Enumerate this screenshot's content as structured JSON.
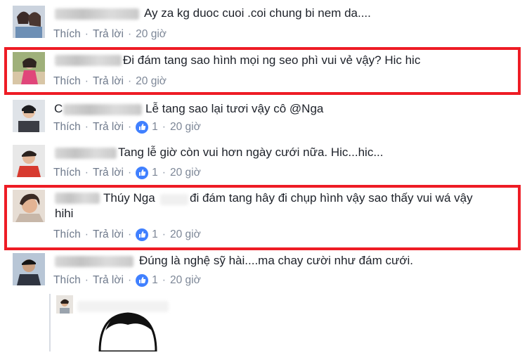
{
  "comments": [
    {
      "id": "c1",
      "text": "Ay za kg duoc cuoi .coi chung bi nem da....",
      "like_label": "Thích",
      "reply_label": "Trả lời",
      "reactions": "",
      "time": "20 giờ"
    },
    {
      "id": "c2",
      "text": "Đi đám tang sao hình mọi ng seo phì vui vẻ vậy? Hic hic",
      "like_label": "Thích",
      "reply_label": "Trả lời",
      "reactions": "",
      "time": "20 giờ"
    },
    {
      "id": "c3",
      "text_prefix": "C",
      "text": "Lễ tang sao lại tươi vậy cô @Nga",
      "like_label": "Thích",
      "reply_label": "Trả lời",
      "reactions": "1",
      "time": "20 giờ"
    },
    {
      "id": "c4",
      "text": "Tang lễ giờ còn vui hơn ngày cưới nữa. Hic...hic...",
      "like_label": "Thích",
      "reply_label": "Trả lời",
      "reactions": "1",
      "time": "20 giờ"
    },
    {
      "id": "c5",
      "mention": "Thúy Nga",
      "text": "đi đám tang hây đi chụp hình vậy sao thấy vui wá vậy",
      "text_line2": "hihi",
      "like_label": "Thích",
      "reply_label": "Trả lời",
      "reactions": "1",
      "time": "20 giờ"
    },
    {
      "id": "c6",
      "text": "Đúng là nghệ sỹ hài....ma chay cười như đám cưới.",
      "like_label": "Thích",
      "reply_label": "Trả lời",
      "reactions": "1",
      "time": "20 giờ"
    }
  ],
  "colors": {
    "highlight": "#ee1c25",
    "like_blue": "#4080ff",
    "link_gray": "#7d8797"
  },
  "icons": {
    "like": "thumbs-up-icon"
  }
}
